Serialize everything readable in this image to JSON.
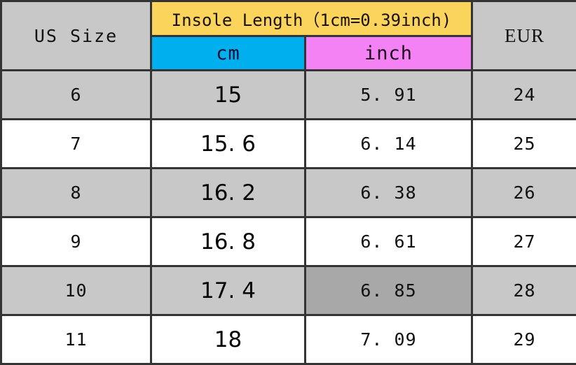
{
  "table": {
    "header": {
      "us_size": "US Size",
      "insole_group": "Insole Length（1cm=0.39inch)",
      "cm": "cm",
      "inch": "inch",
      "eur": "EUR"
    },
    "columns": [
      "US Size",
      "cm",
      "inch",
      "EUR"
    ],
    "colors": {
      "insole_group_bg": "#fbd45c",
      "cm_bg": "#00b0ee",
      "inch_bg": "#f582f5",
      "row_gray_bg": "#c8c8c8",
      "row_white_bg": "#ffffff",
      "highlight_bg": "#a8a8a8",
      "border": "#343434",
      "text": "#111111"
    },
    "rows": [
      {
        "us": "6",
        "cm": "15",
        "inch": "5. 91",
        "eur": "24",
        "shade": "gray",
        "highlight": false
      },
      {
        "us": "7",
        "cm": "15. 6",
        "inch": "6. 14",
        "eur": "25",
        "shade": "white",
        "highlight": false
      },
      {
        "us": "8",
        "cm": "16. 2",
        "inch": "6. 38",
        "eur": "26",
        "shade": "gray",
        "highlight": false
      },
      {
        "us": "9",
        "cm": "16. 8",
        "inch": "6. 61",
        "eur": "27",
        "shade": "white",
        "highlight": false
      },
      {
        "us": "10",
        "cm": "17. 4",
        "inch": "6. 85",
        "eur": "28",
        "shade": "gray",
        "highlight": true
      },
      {
        "us": "11",
        "cm": "18",
        "inch": "7. 09",
        "eur": "29",
        "shade": "white",
        "highlight": false
      }
    ]
  }
}
